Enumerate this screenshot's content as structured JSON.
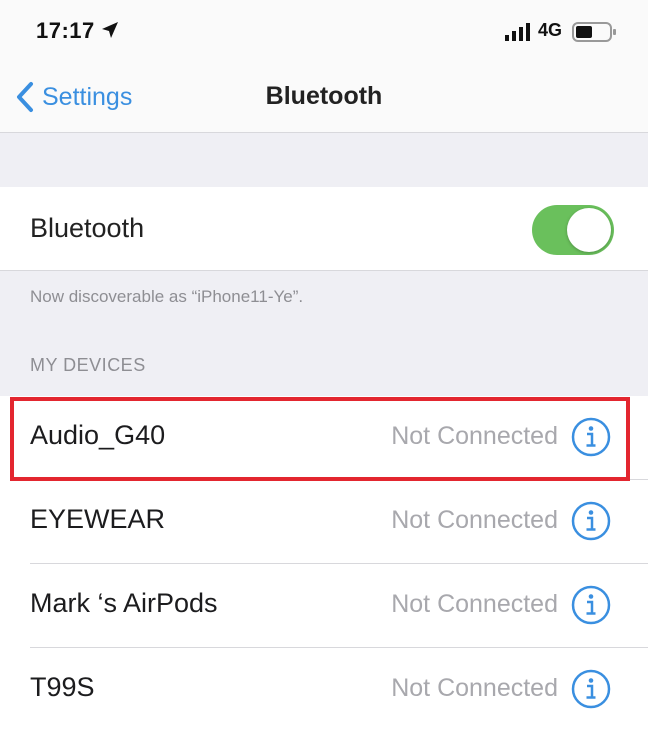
{
  "status_bar": {
    "time": "17:17",
    "network": "4G",
    "icons": [
      "location-arrow-icon",
      "cellular-signal-icon",
      "battery-icon"
    ]
  },
  "nav": {
    "back_label": "Settings",
    "title": "Bluetooth"
  },
  "bluetooth": {
    "label": "Bluetooth",
    "enabled": true,
    "toggle_color": "#6ac05c"
  },
  "discoverable_text": "Now discoverable as “iPhone11-Ye”.",
  "section_header": "MY DEVICES",
  "devices": [
    {
      "name": "Audio_G40",
      "status": "Not Connected",
      "highlighted": true
    },
    {
      "name": "EYEWEAR",
      "status": "Not Connected",
      "highlighted": false
    },
    {
      "name": "Mark ‘s AirPods",
      "status": "Not Connected",
      "highlighted": false
    },
    {
      "name": "T99S",
      "status": "Not Connected",
      "highlighted": false
    }
  ],
  "colors": {
    "accent": "#3a8fe0",
    "highlight": "#e3262f",
    "secondary_text": "#a8a8ad",
    "grouped_background": "#efeff4"
  }
}
